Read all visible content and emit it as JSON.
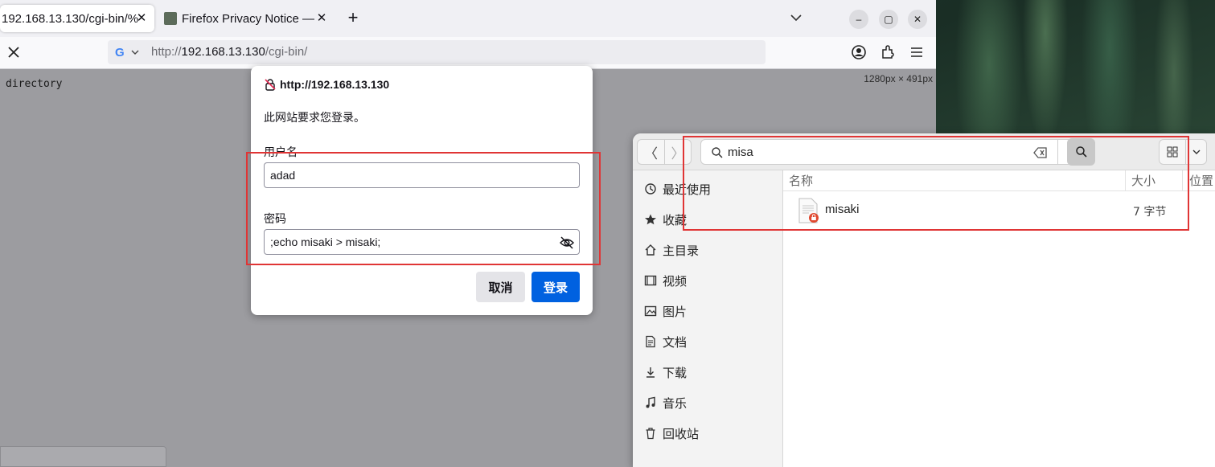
{
  "firefox": {
    "tabs": [
      {
        "title": "192.168.13.130/cgi-bin/%",
        "active": true
      },
      {
        "title": "Firefox Privacy Notice —",
        "active": false
      }
    ],
    "tab_close_glyph": "✕",
    "new_tab_glyph": "+",
    "window_buttons": {
      "minimize": "–",
      "maximize": "▢",
      "close": "✕"
    },
    "url": {
      "scheme": "http://",
      "host": "192.168.13.130",
      "path": "/cgi-bin/"
    },
    "search_engine": "G",
    "page_text": "directory",
    "viewport_size": "1280px × 491px"
  },
  "dialog": {
    "origin": "http://192.168.13.130",
    "message": "此网站要求您登录。",
    "username_label": "用户名",
    "username_value": "adad",
    "password_label": "密码",
    "password_value": ";echo misaki > misaki;",
    "cancel_label": "取消",
    "login_label": "登录"
  },
  "file_manager": {
    "search_query": "misa",
    "nav_back": "〈",
    "nav_forward": "〉",
    "sidebar": [
      {
        "label": "最近使用",
        "icon": "clock-icon"
      },
      {
        "label": "收藏",
        "icon": "star-icon"
      },
      {
        "label": "主目录",
        "icon": "home-icon"
      },
      {
        "label": "视频",
        "icon": "video-icon"
      },
      {
        "label": "图片",
        "icon": "image-icon"
      },
      {
        "label": "文档",
        "icon": "document-icon"
      },
      {
        "label": "下载",
        "icon": "download-icon"
      },
      {
        "label": "音乐",
        "icon": "music-icon"
      },
      {
        "label": "回收站",
        "icon": "trash-icon"
      }
    ],
    "columns": {
      "name": "名称",
      "size": "大小",
      "location": "位置"
    },
    "files": [
      {
        "name": "misaki",
        "size": "7 字节"
      }
    ]
  },
  "colors": {
    "accent": "#0061e0",
    "highlight_box": "#e03535"
  }
}
